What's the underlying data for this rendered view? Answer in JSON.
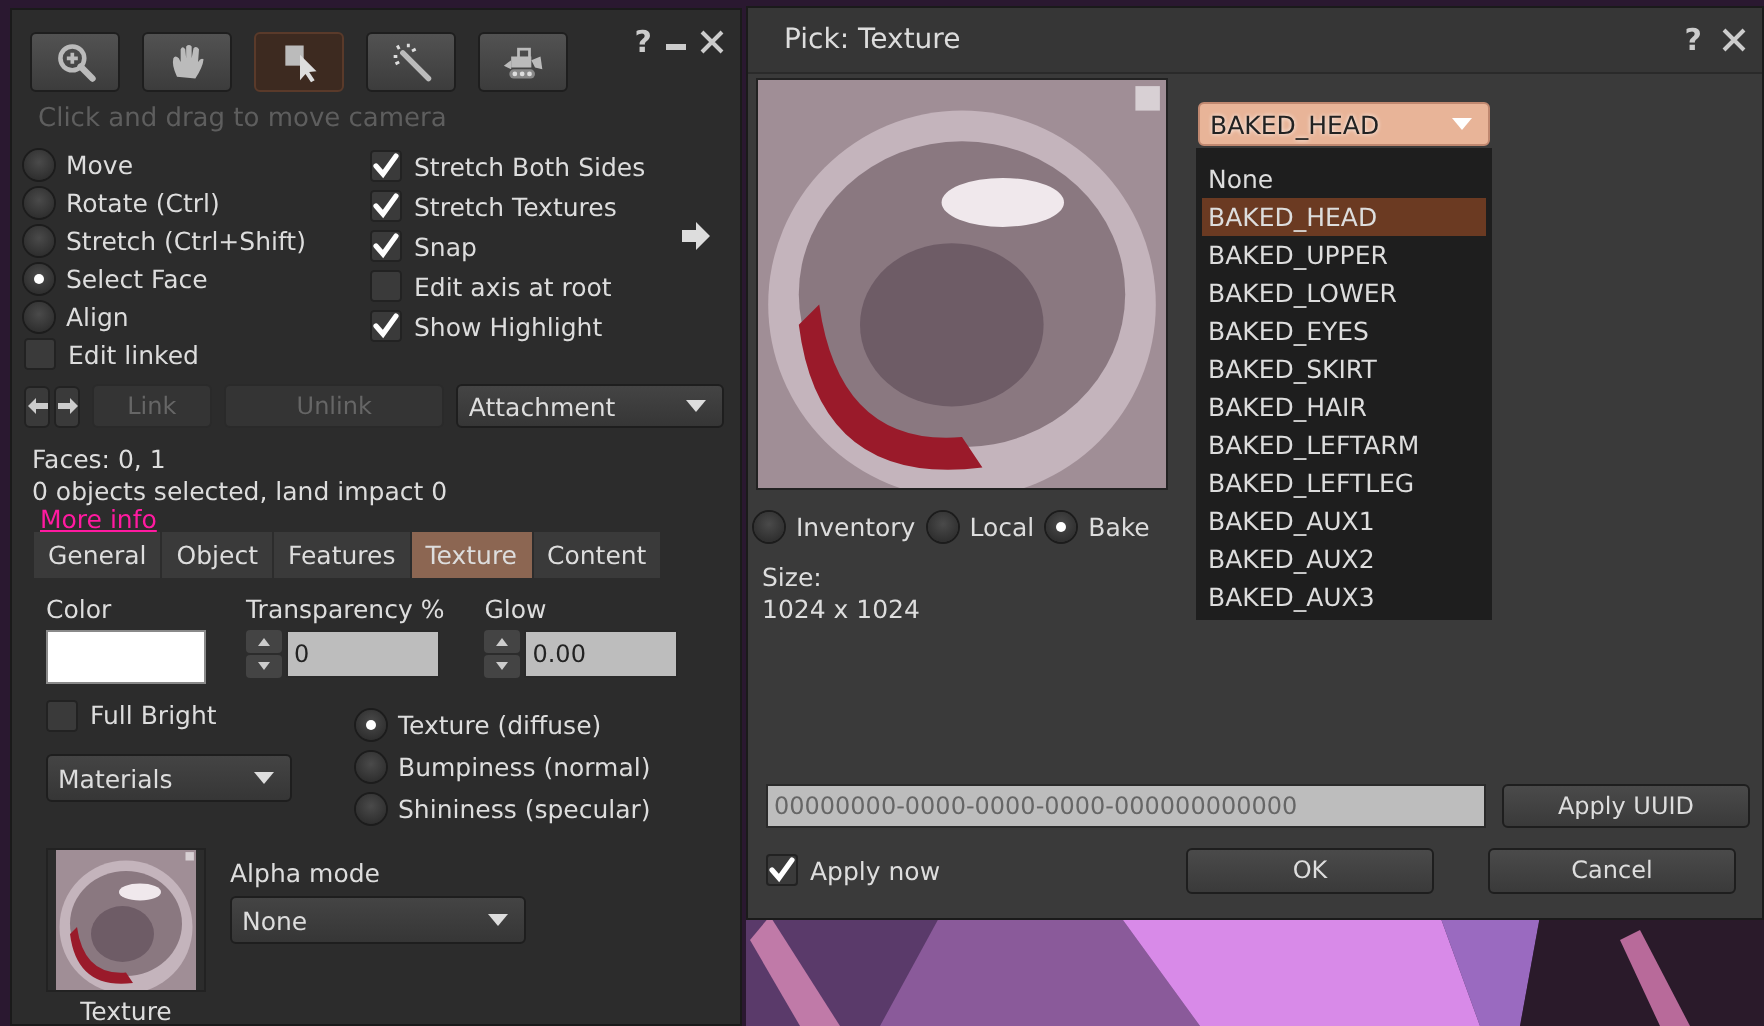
{
  "tools_panel": {
    "help": "?",
    "tool_buttons": [
      {
        "selected": false
      },
      {
        "selected": false
      },
      {
        "selected": true
      },
      {
        "selected": false
      },
      {
        "selected": false
      }
    ],
    "hint": "Click and drag to move camera",
    "modes": [
      {
        "label": "Move",
        "selected": false
      },
      {
        "label": "Rotate (Ctrl)",
        "selected": false
      },
      {
        "label": "Stretch (Ctrl+Shift)",
        "selected": false
      },
      {
        "label": "Select Face",
        "selected": true
      },
      {
        "label": "Align",
        "selected": false
      }
    ],
    "edit_linked": {
      "label": "Edit linked",
      "checked": false
    },
    "options": [
      {
        "label": "Stretch Both Sides",
        "checked": true
      },
      {
        "label": "Stretch Textures",
        "checked": true
      },
      {
        "label": "Snap",
        "checked": true
      },
      {
        "label": "Edit axis at root",
        "checked": false
      },
      {
        "label": "Show Highlight",
        "checked": true
      }
    ],
    "link_buttons": [
      {
        "label": "Link",
        "disabled": true
      },
      {
        "label": "Unlink",
        "disabled": true
      }
    ],
    "attachment": "Attachment",
    "faces": "Faces: 0, 1",
    "selection": "0 objects selected, land impact 0",
    "more_info": "More info",
    "tabs": [
      {
        "label": "General",
        "selected": false
      },
      {
        "label": "Object",
        "selected": false
      },
      {
        "label": "Features",
        "selected": false
      },
      {
        "label": "Texture",
        "selected": true
      },
      {
        "label": "Content",
        "selected": false
      }
    ],
    "color": {
      "label": "Color",
      "color": "#ffffff"
    },
    "transparency": {
      "label": "Transparency %",
      "value": "0"
    },
    "glow": {
      "label": "Glow",
      "value": "0.00"
    },
    "full_bright": {
      "label": "Full Bright",
      "checked": false
    },
    "materials": "Materials",
    "map_types": [
      {
        "label": "Texture (diffuse)",
        "selected": true
      },
      {
        "label": "Bumpiness (normal)",
        "selected": false
      },
      {
        "label": "Shininess (specular)",
        "selected": false
      }
    ],
    "texture": {
      "label": "Texture"
    },
    "alpha_mode": {
      "label": "Alpha mode",
      "value": "None"
    }
  },
  "texture_picker": {
    "title": "Pick: Texture",
    "help": "?",
    "sources": [
      {
        "label": "Inventory",
        "selected": false
      },
      {
        "label": "Local",
        "selected": false
      },
      {
        "label": "Bake",
        "selected": true
      }
    ],
    "size_label": "Size:",
    "size": "1024 x 1024",
    "bake_dropdown": {
      "value": "BAKED_HEAD",
      "options": [
        {
          "label": "None",
          "selected": false
        },
        {
          "label": "BAKED_HEAD",
          "selected": true
        },
        {
          "label": "BAKED_UPPER",
          "selected": false
        },
        {
          "label": "BAKED_LOWER",
          "selected": false
        },
        {
          "label": "BAKED_EYES",
          "selected": false
        },
        {
          "label": "BAKED_SKIRT",
          "selected": false
        },
        {
          "label": "BAKED_HAIR",
          "selected": false
        },
        {
          "label": "BAKED_LEFTARM",
          "selected": false
        },
        {
          "label": "BAKED_LEFTLEG",
          "selected": false
        },
        {
          "label": "BAKED_AUX1",
          "selected": false
        },
        {
          "label": "BAKED_AUX2",
          "selected": false
        },
        {
          "label": "BAKED_AUX3",
          "selected": false
        }
      ]
    },
    "uuid": "00000000-0000-0000-0000-000000000000",
    "apply_uuid": "Apply UUID",
    "apply_now": {
      "label": "Apply now",
      "checked": true
    },
    "buttons": [
      "OK",
      "Cancel"
    ]
  }
}
